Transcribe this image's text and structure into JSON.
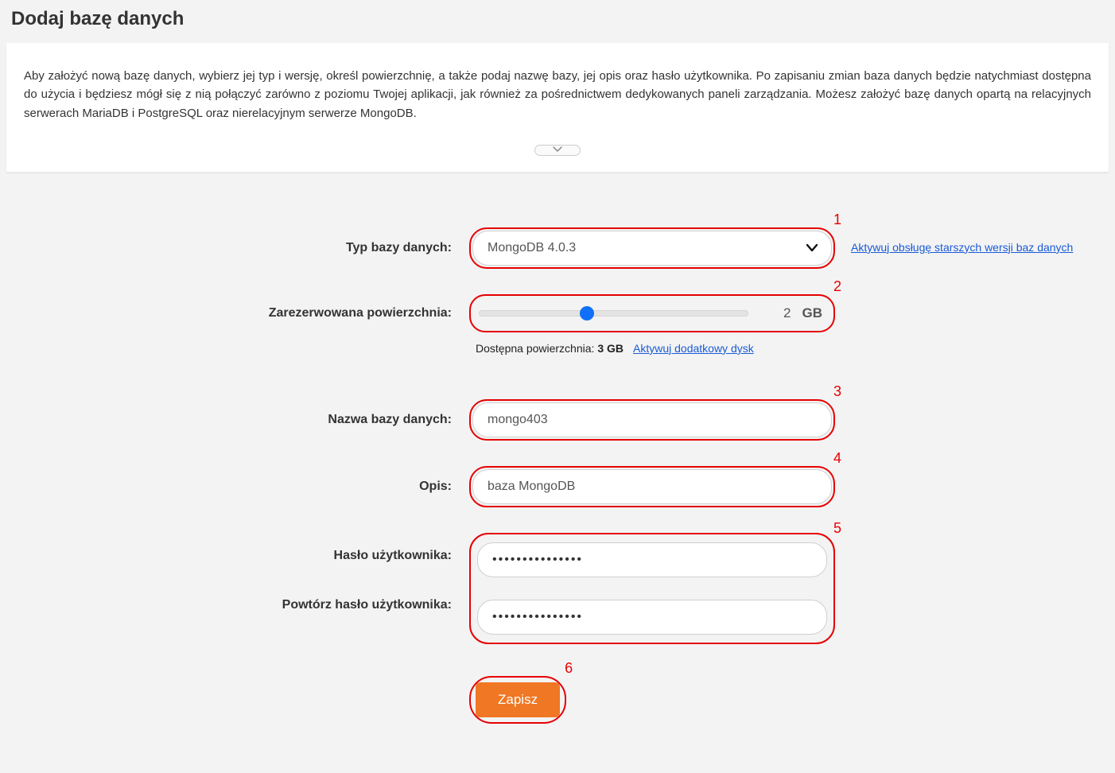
{
  "title": "Dodaj bazę danych",
  "info_text": "Aby założyć nową bazę danych, wybierz jej typ i wersję, określ powierzchnię, a także podaj nazwę bazy, jej opis oraz hasło użytkownika. Po zapisaniu zmian baza danych będzie natychmiast dostępna do użycia i będziesz mógł się z nią połączyć zarówno z poziomu Twojej aplikacji, jak również za pośrednictwem dedykowanych paneli zarządzania. Możesz założyć bazę danych opartą na relacyjnych serwerach MariaDB i PostgreSQL oraz nierelacyjnym serwerze MongoDB.",
  "form": {
    "db_type": {
      "label": "Typ bazy danych:",
      "value": "MongoDB 4.0.3",
      "legacy_link": "Aktywuj obsługę starszych wersji baz danych"
    },
    "reserved": {
      "label": "Zarezerwowana powierzchnia:",
      "value": "2",
      "unit": "GB",
      "hint_label": "Dostępna powierzchnia: ",
      "hint_value": "3 GB",
      "extra_link": "Aktywuj dodatkowy dysk"
    },
    "db_name": {
      "label": "Nazwa bazy danych:",
      "value": "mongo403"
    },
    "desc": {
      "label": "Opis:",
      "value": "baza MongoDB"
    },
    "password": {
      "label": "Hasło użytkownika:",
      "value": "passwordpasswor"
    },
    "password_repeat": {
      "label": "Powtórz hasło użytkownika:",
      "value": "passwordpasswor"
    },
    "save_label": "Zapisz"
  },
  "markers": {
    "m1": "1",
    "m2": "2",
    "m3": "3",
    "m4": "4",
    "m5": "5",
    "m6": "6"
  }
}
